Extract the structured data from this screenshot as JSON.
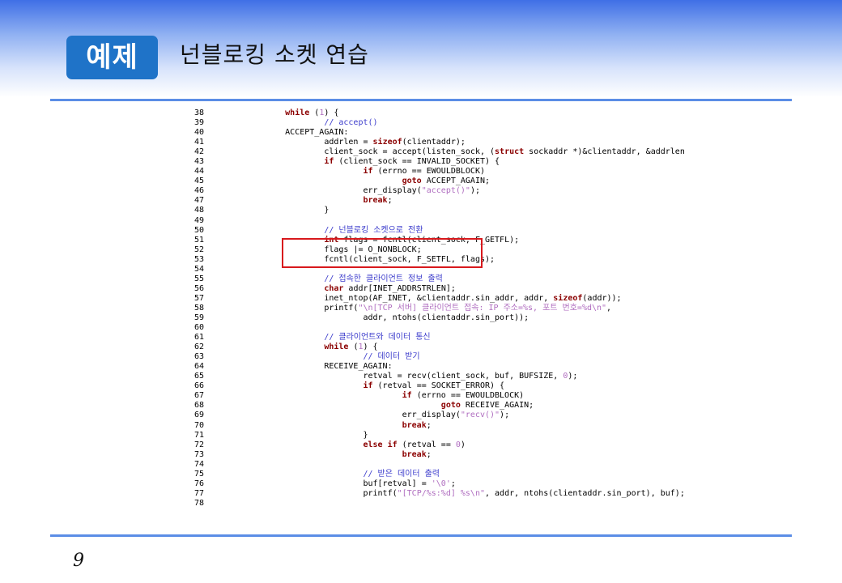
{
  "header": {
    "badge": "예제",
    "title": "넌블로킹 소켓 연습"
  },
  "code": [
    {
      "n": "38",
      "indent": 8,
      "tokens": [
        {
          "t": "while",
          "c": "kw"
        },
        {
          "t": " ("
        },
        {
          "t": "1",
          "c": "nm"
        },
        {
          "t": ") {"
        }
      ]
    },
    {
      "n": "39",
      "indent": 16,
      "tokens": [
        {
          "t": "// accept()",
          "c": "cm"
        }
      ]
    },
    {
      "n": "40",
      "indent": 8,
      "tokens": [
        {
          "t": "ACCEPT_AGAIN:"
        }
      ]
    },
    {
      "n": "41",
      "indent": 16,
      "tokens": [
        {
          "t": "addrlen = "
        },
        {
          "t": "sizeof",
          "c": "kw"
        },
        {
          "t": "(clientaddr);"
        }
      ]
    },
    {
      "n": "42",
      "indent": 16,
      "tokens": [
        {
          "t": "client_sock = accept(listen_sock, ("
        },
        {
          "t": "struct",
          "c": "kw"
        },
        {
          "t": " sockaddr *)&clientaddr, &addrlen"
        }
      ]
    },
    {
      "n": "43",
      "indent": 16,
      "tokens": [
        {
          "t": "if",
          "c": "kw"
        },
        {
          "t": " (client_sock == INVALID_SOCKET) {"
        }
      ]
    },
    {
      "n": "44",
      "indent": 24,
      "tokens": [
        {
          "t": "if",
          "c": "kw"
        },
        {
          "t": " (errno == EWOULDBLOCK)"
        }
      ]
    },
    {
      "n": "45",
      "indent": 32,
      "tokens": [
        {
          "t": "goto",
          "c": "kw"
        },
        {
          "t": " ACCEPT_AGAIN;"
        }
      ]
    },
    {
      "n": "46",
      "indent": 24,
      "tokens": [
        {
          "t": "err_display("
        },
        {
          "t": "\"accept()\"",
          "c": "st"
        },
        {
          "t": ");"
        }
      ]
    },
    {
      "n": "47",
      "indent": 24,
      "tokens": [
        {
          "t": "break",
          "c": "kw"
        },
        {
          "t": ";"
        }
      ]
    },
    {
      "n": "48",
      "indent": 16,
      "tokens": [
        {
          "t": "}"
        }
      ]
    },
    {
      "n": "49",
      "indent": 0,
      "tokens": []
    },
    {
      "n": "50",
      "indent": 16,
      "tokens": [
        {
          "t": "// 넌블로킹 소켓으로 전환",
          "c": "cm"
        }
      ]
    },
    {
      "n": "51",
      "indent": 16,
      "tokens": [
        {
          "t": "int",
          "c": "kw"
        },
        {
          "t": " flags = fcntl(client_sock, F_GETFL);"
        }
      ]
    },
    {
      "n": "52",
      "indent": 16,
      "tokens": [
        {
          "t": "flags |= O_NONBLOCK;"
        }
      ]
    },
    {
      "n": "53",
      "indent": 16,
      "tokens": [
        {
          "t": "fcntl(client_sock, F_SETFL, flags);"
        }
      ]
    },
    {
      "n": "54",
      "indent": 0,
      "tokens": []
    },
    {
      "n": "55",
      "indent": 16,
      "tokens": [
        {
          "t": "// 접속한 클라이언트 정보 출력",
          "c": "cm"
        }
      ]
    },
    {
      "n": "56",
      "indent": 16,
      "tokens": [
        {
          "t": "char",
          "c": "kw"
        },
        {
          "t": " addr[INET_ADDRSTRLEN];"
        }
      ]
    },
    {
      "n": "57",
      "indent": 16,
      "tokens": [
        {
          "t": "inet_ntop(AF_INET, &clientaddr.sin_addr, addr, "
        },
        {
          "t": "sizeof",
          "c": "kw"
        },
        {
          "t": "(addr));"
        }
      ]
    },
    {
      "n": "58",
      "indent": 16,
      "tokens": [
        {
          "t": "printf("
        },
        {
          "t": "\"\\n[TCP 서버] 클라이언트 접속: IP 주소=%s, 포트 번호=%d\\n\"",
          "c": "st"
        },
        {
          "t": ","
        }
      ]
    },
    {
      "n": "59",
      "indent": 24,
      "tokens": [
        {
          "t": "addr, ntohs(clientaddr.sin_port));"
        }
      ]
    },
    {
      "n": "60",
      "indent": 0,
      "tokens": []
    },
    {
      "n": "61",
      "indent": 16,
      "tokens": [
        {
          "t": "// 클라이언트와 데이터 통신",
          "c": "cm"
        }
      ]
    },
    {
      "n": "62",
      "indent": 16,
      "tokens": [
        {
          "t": "while",
          "c": "kw"
        },
        {
          "t": " ("
        },
        {
          "t": "1",
          "c": "nm"
        },
        {
          "t": ") {"
        }
      ]
    },
    {
      "n": "63",
      "indent": 24,
      "tokens": [
        {
          "t": "// 데이터 받기",
          "c": "cm"
        }
      ]
    },
    {
      "n": "64",
      "indent": 16,
      "tokens": [
        {
          "t": "RECEIVE_AGAIN:"
        }
      ]
    },
    {
      "n": "65",
      "indent": 24,
      "tokens": [
        {
          "t": "retval = recv(client_sock, buf, BUFSIZE, "
        },
        {
          "t": "0",
          "c": "nm"
        },
        {
          "t": ");"
        }
      ]
    },
    {
      "n": "66",
      "indent": 24,
      "tokens": [
        {
          "t": "if",
          "c": "kw"
        },
        {
          "t": " (retval == SOCKET_ERROR) {"
        }
      ]
    },
    {
      "n": "67",
      "indent": 32,
      "tokens": [
        {
          "t": "if",
          "c": "kw"
        },
        {
          "t": " (errno == EWOULDBLOCK)"
        }
      ]
    },
    {
      "n": "68",
      "indent": 40,
      "tokens": [
        {
          "t": "goto",
          "c": "kw"
        },
        {
          "t": " RECEIVE_AGAIN;"
        }
      ]
    },
    {
      "n": "69",
      "indent": 32,
      "tokens": [
        {
          "t": "err_display("
        },
        {
          "t": "\"recv()\"",
          "c": "st"
        },
        {
          "t": ");"
        }
      ]
    },
    {
      "n": "70",
      "indent": 32,
      "tokens": [
        {
          "t": "break",
          "c": "kw"
        },
        {
          "t": ";"
        }
      ]
    },
    {
      "n": "71",
      "indent": 24,
      "tokens": [
        {
          "t": "}"
        }
      ]
    },
    {
      "n": "72",
      "indent": 24,
      "tokens": [
        {
          "t": "else if",
          "c": "kw"
        },
        {
          "t": " (retval == "
        },
        {
          "t": "0",
          "c": "nm"
        },
        {
          "t": ")"
        }
      ]
    },
    {
      "n": "73",
      "indent": 32,
      "tokens": [
        {
          "t": "break",
          "c": "kw"
        },
        {
          "t": ";"
        }
      ]
    },
    {
      "n": "74",
      "indent": 0,
      "tokens": []
    },
    {
      "n": "75",
      "indent": 24,
      "tokens": [
        {
          "t": "// 받은 데이터 출력",
          "c": "cm"
        }
      ]
    },
    {
      "n": "76",
      "indent": 24,
      "tokens": [
        {
          "t": "buf[retval] = "
        },
        {
          "t": "'\\0'",
          "c": "st"
        },
        {
          "t": ";"
        }
      ]
    },
    {
      "n": "77",
      "indent": 24,
      "tokens": [
        {
          "t": "printf("
        },
        {
          "t": "\"[TCP/%s:%d] %s\\n\"",
          "c": "st"
        },
        {
          "t": ", addr, ntohs(clientaddr.sin_port), buf);"
        }
      ]
    },
    {
      "n": "78",
      "indent": 0,
      "tokens": []
    }
  ],
  "page_number": "9"
}
